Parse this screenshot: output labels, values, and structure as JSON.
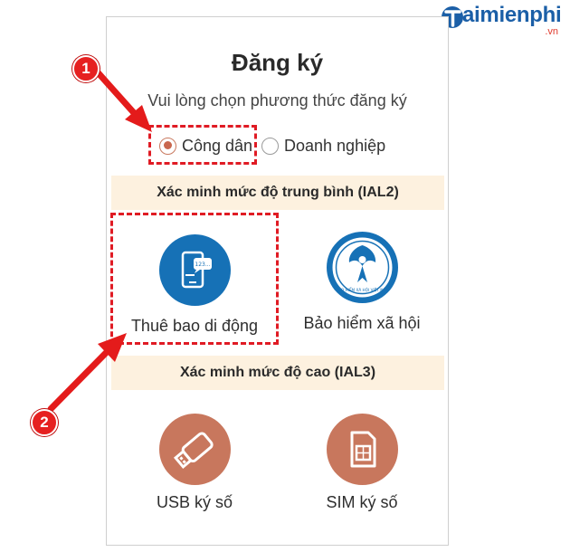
{
  "brand": {
    "logo_text": "aimienphi",
    "logo_domain": ".vn"
  },
  "form": {
    "title": "Đăng ký",
    "subtitle": "Vui lòng chọn phương thức đăng ký",
    "account_types": [
      {
        "label": "Công dân",
        "selected": true
      },
      {
        "label": "Doanh nghiệp",
        "selected": false
      }
    ]
  },
  "sections": [
    {
      "heading": "Xác minh mức độ trung bình (IAL2)",
      "options": [
        {
          "label": "Thuê bao di động",
          "icon": "mobile-phone-icon",
          "color": "#1671b6"
        },
        {
          "label": "Bảo hiểm xã hội",
          "icon": "social-insurance-logo-icon",
          "color": "#1671b6"
        }
      ]
    },
    {
      "heading": "Xác minh mức độ cao (IAL3)",
      "options": [
        {
          "label": "USB ký số",
          "icon": "usb-drive-icon",
          "color": "#c8775d"
        },
        {
          "label": "SIM ký số",
          "icon": "sim-card-icon",
          "color": "#c8775d"
        }
      ]
    }
  ],
  "annotations": {
    "marker_1": "1",
    "marker_2": "2",
    "highlight_color": "#e01b24"
  },
  "insurance_logo_text": "BẢO HIỂM XÃ HỘI VIỆT NAM",
  "phone_icon_text": "123..."
}
